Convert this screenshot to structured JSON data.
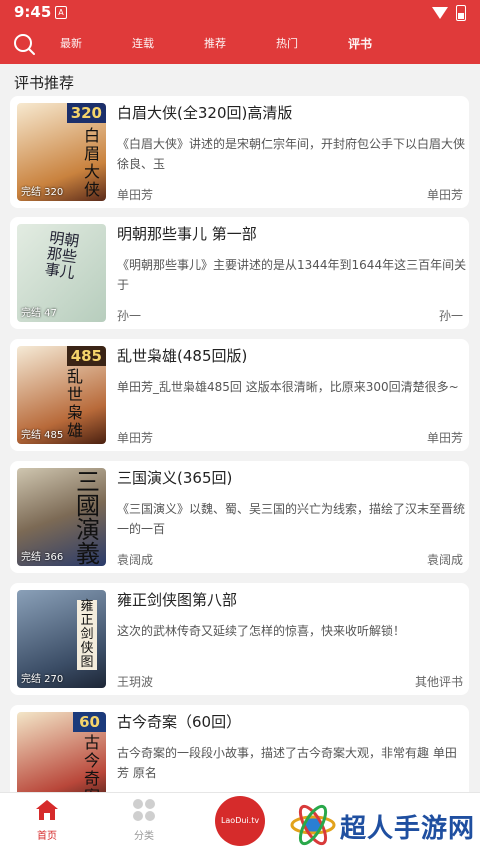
{
  "status_bar": {
    "time": "9:45",
    "notification_glyph": "A"
  },
  "top_nav": {
    "tabs": [
      {
        "label": "最新"
      },
      {
        "label": "连载"
      },
      {
        "label": "推荐"
      },
      {
        "label": "热门"
      },
      {
        "label": "评书"
      }
    ],
    "active_tab": "评书"
  },
  "section_title": "评书推荐",
  "books": [
    {
      "title": "白眉大侠(全320回)高清版",
      "desc": "《白眉大侠》讲述的是宋朝仁宗年间，开封府包公手下以白眉大侠徐良、玉",
      "author": "单田芳",
      "narrator": "单田芳",
      "status": "完结 320",
      "cover_number": "320",
      "cover_text": "白眉大侠"
    },
    {
      "title": "明朝那些事儿 第一部",
      "desc": "《明朝那些事儿》主要讲述的是从1344年到1644年这三百年间关于",
      "author": "孙一",
      "narrator": "孙一",
      "status": "完结 47",
      "cover_number": "",
      "cover_text": "明朝那些事儿"
    },
    {
      "title": "乱世枭雄(485回版)",
      "desc": "单田芳_乱世枭雄485回  这版本很清晰，比原来300回清楚很多~",
      "author": "单田芳",
      "narrator": "单田芳",
      "status": "完结 485",
      "cover_number": "485",
      "cover_text": "乱世枭雄"
    },
    {
      "title": "三国演义(365回)",
      "desc": "《三国演义》以魏、蜀、吴三国的兴亡为线索，描绘了汉末至晋统一的一百",
      "author": "袁阔成",
      "narrator": "袁阔成",
      "status": "完结 366",
      "cover_number": "",
      "cover_text": "三國演義"
    },
    {
      "title": "雍正剑侠图第八部",
      "desc": "这次的武林传奇又延续了怎样的惊喜，快来收听解锁！",
      "author": "王玥波",
      "narrator": "其他评书",
      "status": "完结 270",
      "cover_number": "",
      "cover_text": "雍正剑侠图"
    },
    {
      "title": "古今奇案（60回）",
      "desc": "古今奇案的一段段小故事，描述了古今奇案大观，非常有趣 单田芳 原名",
      "author": "",
      "narrator": "",
      "status": "",
      "cover_number": "60",
      "cover_text": "古今奇案"
    }
  ],
  "bottom_nav": {
    "items": [
      {
        "label": "首页"
      },
      {
        "label": "分类"
      }
    ],
    "center_label": "LaoDui.tv"
  },
  "watermark": {
    "text": "超人手游网"
  },
  "colors": {
    "primary": "#e03a3a",
    "background": "#f2f2f2"
  }
}
